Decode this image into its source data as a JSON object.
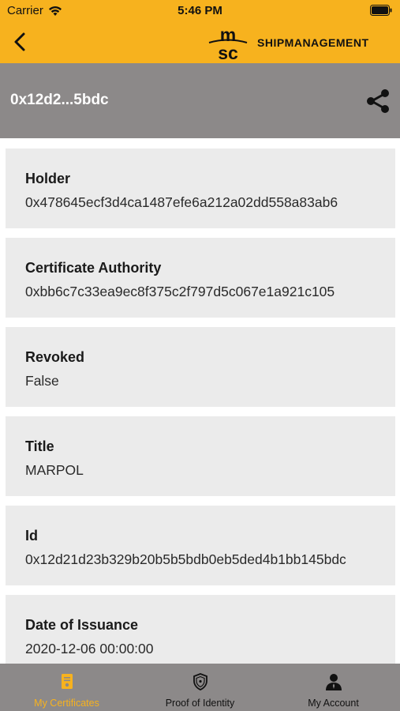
{
  "status_bar": {
    "carrier": "Carrier",
    "time": "5:46 PM"
  },
  "header": {
    "brand_text": "SHIPMANAGEMENT",
    "logo_letters": "msc"
  },
  "title_bar": {
    "title": "0x12d2...5bdc"
  },
  "fields": [
    {
      "label": "Holder",
      "value": "0x478645ecf3d4ca1487efe6a212a02dd558a83ab6"
    },
    {
      "label": "Certificate Authority",
      "value": "0xbb6c7c33ea9ec8f375c2f797d5c067e1a921c105"
    },
    {
      "label": "Revoked",
      "value": "False"
    },
    {
      "label": "Title",
      "value": "MARPOL"
    },
    {
      "label": "Id",
      "value": "0x12d21d23b329b20b5b5bdb0eb5ded4b1bb145bdc"
    },
    {
      "label": "Date of Issuance",
      "value": "2020-12-06 00:00:00"
    }
  ],
  "tabs": [
    {
      "label": "My Certificates",
      "icon": "certificate-icon",
      "active": true
    },
    {
      "label": "Proof of Identity",
      "icon": "shield-icon",
      "active": false
    },
    {
      "label": "My Account",
      "icon": "person-icon",
      "active": false
    }
  ],
  "colors": {
    "brand_yellow": "#f7b21e",
    "header_gray": "#8c8989",
    "card_bg": "#ebebeb"
  }
}
